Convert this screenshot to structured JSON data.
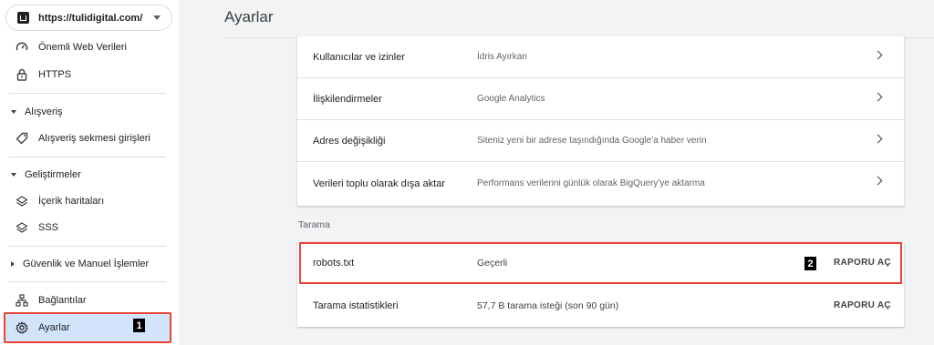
{
  "property": {
    "url": "https://tulidigital.com/"
  },
  "sidebar": {
    "items_top": [
      {
        "label": "Önemli Web Verileri",
        "icon": "speedometer-icon"
      },
      {
        "label": "HTTPS",
        "icon": "lock-icon"
      }
    ],
    "shopping": {
      "group_label": "Alışveriş",
      "items": [
        {
          "label": "Alışveriş sekmesi girişleri",
          "icon": "tag-icon"
        }
      ]
    },
    "enhancements": {
      "group_label": "Geliştirmeler",
      "items": [
        {
          "label": "İçerik haritaları",
          "icon": "layers-icon"
        },
        {
          "label": "SSS",
          "icon": "layers-icon"
        }
      ]
    },
    "security": {
      "group_label": "Güvenlik ve Manuel İşlemler"
    },
    "links": {
      "label": "Bağlantılar",
      "icon": "sitemap-icon"
    },
    "settings": {
      "label": "Ayarlar",
      "icon": "gear-icon",
      "badge": "1"
    }
  },
  "main": {
    "title": "Ayarlar",
    "general_rows": [
      {
        "name": "Kullanıcılar ve izinler",
        "desc": "İdris Ayırkan"
      },
      {
        "name": "İlişkilendirmeler",
        "desc": "Google Analytics"
      },
      {
        "name": "Adres değişikliği",
        "desc": "Siteniz yeni bir adrese taşındığında Google'a haber verin"
      },
      {
        "name": "Verileri toplu olarak dışa aktar",
        "desc": "Performans verilerini günlük olarak BigQuery'ye aktarma"
      }
    ],
    "crawl_section_label": "Tarama",
    "crawl_rows": [
      {
        "name": "robots.txt",
        "desc": "Geçerli",
        "action": "RAPORU AÇ",
        "badge": "2"
      },
      {
        "name": "Tarama istatistikleri",
        "desc": "57,7 B tarama isteği (son 90 gün)",
        "action": "RAPORU AÇ"
      }
    ]
  },
  "colors": {
    "highlight": "#ea4335",
    "active_bg": "#d2e3fc"
  }
}
